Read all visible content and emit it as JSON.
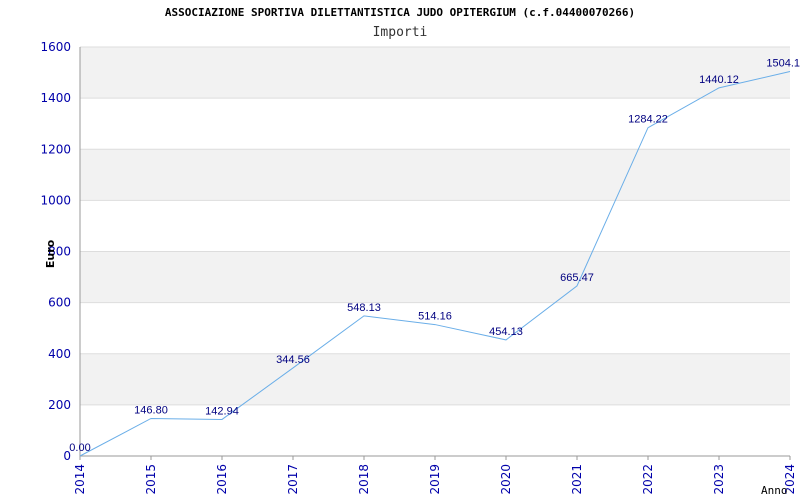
{
  "chart_data": {
    "type": "line",
    "title": "ASSOCIAZIONE SPORTIVA DILETTANTISTICA JUDO OPITERGIUM (c.f.04400070266)",
    "subtitle": "Importi",
    "xlabel": "Anno",
    "ylabel": "Euro",
    "categories": [
      "2014",
      "2015",
      "2016",
      "2017",
      "2018",
      "2019",
      "2020",
      "2021",
      "2022",
      "2023",
      "2024"
    ],
    "values": [
      0.0,
      146.8,
      142.94,
      344.56,
      548.13,
      514.16,
      454.13,
      665.47,
      1284.22,
      1440.12,
      1504.1
    ],
    "data_labels": [
      "0.00",
      "146.80",
      "142.94",
      "344.56",
      "548.13",
      "514.16",
      "454.13",
      "665.47",
      "1284.22",
      "1440.12",
      "1504.1"
    ],
    "ylim": [
      0,
      1600
    ],
    "yticks": [
      0,
      200,
      400,
      600,
      800,
      1000,
      1200,
      1400,
      1600
    ],
    "grid": true,
    "line_color": "#6aaee8",
    "band_color": "#f2f2f2",
    "tick_color": "#0000aa"
  }
}
